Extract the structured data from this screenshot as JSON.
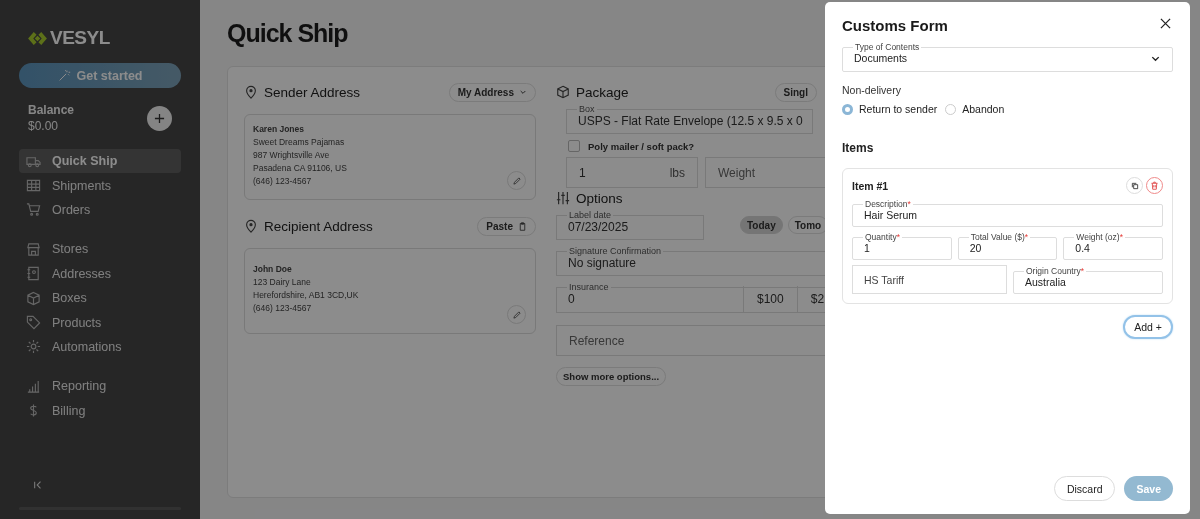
{
  "sidebar": {
    "logo": "VESYL",
    "get_started": "Get started",
    "balance_label": "Balance",
    "balance": "$0.00",
    "nav_groups": [
      [
        {
          "label": "Quick Ship",
          "selected": true
        },
        {
          "label": "Shipments",
          "selected": false
        },
        {
          "label": "Orders",
          "selected": false
        }
      ],
      [
        {
          "label": "Stores",
          "selected": false
        },
        {
          "label": "Addresses",
          "selected": false
        },
        {
          "label": "Boxes",
          "selected": false
        },
        {
          "label": "Products",
          "selected": false
        },
        {
          "label": "Automations",
          "selected": false
        }
      ],
      [
        {
          "label": "Reporting",
          "selected": false
        },
        {
          "label": "Billing",
          "selected": false
        }
      ]
    ]
  },
  "page": {
    "title": "Quick Ship",
    "sender": {
      "heading": "Sender Address",
      "button": "My Address",
      "lines": [
        "Karen Jones",
        "Sweet Dreams Pajamas",
        "987 Wrightsville Ave",
        "Pasadena CA 91106, US",
        "(646) 123-4567"
      ]
    },
    "recipient": {
      "heading": "Recipient Address",
      "button": "Paste",
      "lines": [
        "John Doe",
        "123 Dairy Lane",
        "Herefordshire, AB1 3CD,UK",
        "(646) 123-4567"
      ]
    },
    "package": {
      "heading": "Package",
      "button": "Singl",
      "box": {
        "label": "Box",
        "value": "USPS - Flat Rate Envelope (12.5 x 9.5 x 0"
      },
      "poly": {
        "label": "Poly mailer / soft pack?",
        "checked": false
      },
      "weight_lbs": {
        "value": "1",
        "unit": "lbs"
      },
      "weight_oz": {
        "placeholder": "Weight"
      }
    },
    "options": {
      "heading": "Options",
      "label_date": {
        "label": "Label date",
        "value": "07/23/2025"
      },
      "date_buttons": [
        {
          "label": "Today",
          "selected": true
        },
        {
          "label": "Tomo",
          "selected": false
        }
      ],
      "signature": {
        "label": "Signature Confirmation",
        "value": "No signature"
      },
      "insurance": {
        "label": "Insurance",
        "value": "0",
        "presets": [
          "$100",
          "$2"
        ]
      },
      "reference": {
        "placeholder": "Reference"
      },
      "more_button": "Show more options..."
    }
  },
  "modal": {
    "title": "Customs Form",
    "type_of_contents": {
      "label": "Type of Contents",
      "value": "Documents"
    },
    "non_delivery": {
      "label": "Non-delivery",
      "options": [
        {
          "label": "Return to sender",
          "selected": true
        },
        {
          "label": "Abandon",
          "selected": false
        }
      ]
    },
    "items_heading": "Items",
    "items": [
      {
        "title": "Item #1",
        "description": {
          "label": "Description",
          "mark": "*",
          "value": "Hair Serum"
        },
        "quantity": {
          "label": "Quantity",
          "mark": "*",
          "value": "1"
        },
        "total_value": {
          "label": "Total Value ($)",
          "mark": "*",
          "value": "20"
        },
        "weight": {
          "label": "Weight (oz)",
          "mark": "*",
          "value": "0.4"
        },
        "hs_tariff": {
          "placeholder": "HS Tariff"
        },
        "origin_country": {
          "label": "Origin Country",
          "mark": "*",
          "value": "Australia"
        }
      }
    ],
    "add_button": "Add +",
    "discard_button": "Discard",
    "save_button": {
      "label": "Save",
      "disabled": true
    }
  }
}
